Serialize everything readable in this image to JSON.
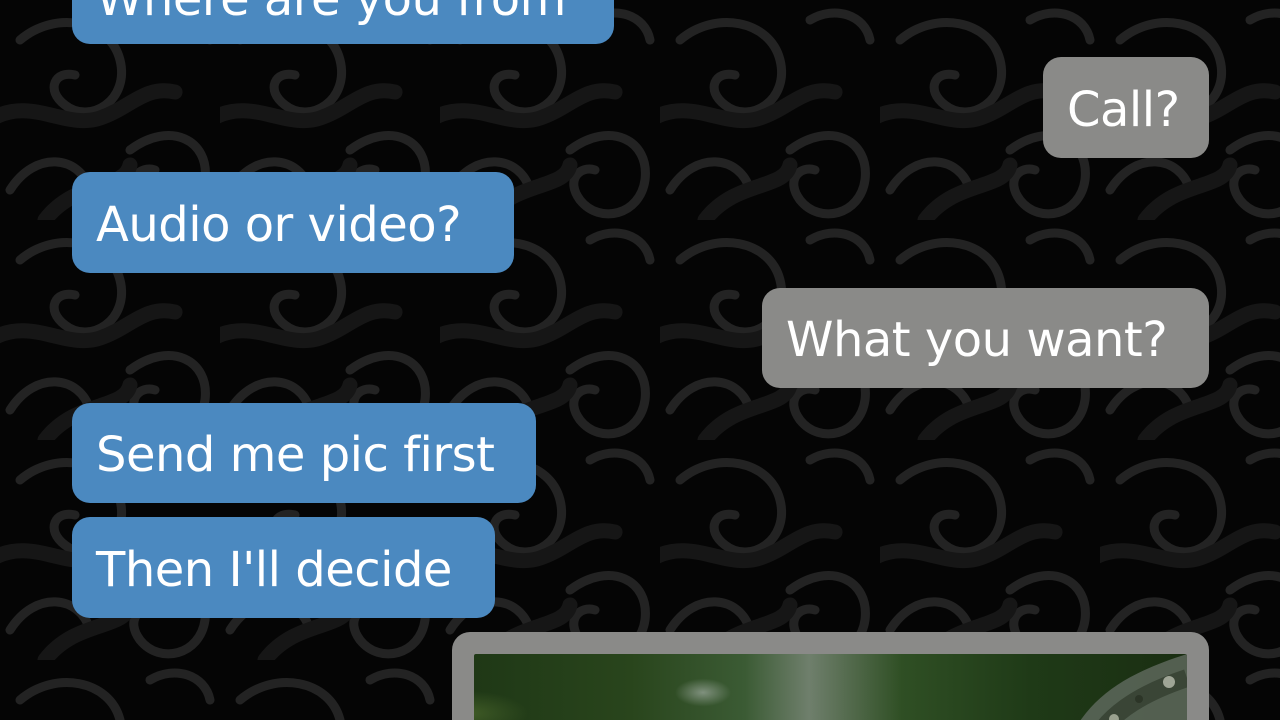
{
  "chat": {
    "messages": [
      {
        "direction": "incoming",
        "text": "Where are you from"
      },
      {
        "direction": "outgoing",
        "text": "Call?"
      },
      {
        "direction": "incoming",
        "text": "Audio or video?"
      },
      {
        "direction": "outgoing",
        "text": "What you want?"
      },
      {
        "direction": "incoming",
        "text": "Send me pic first"
      },
      {
        "direction": "incoming",
        "text": "Then I'll decide"
      }
    ],
    "attachment": {
      "direction": "outgoing",
      "type": "photo"
    }
  },
  "colors": {
    "incoming_bubble": "#4b89c0",
    "outgoing_bubble": "#8a8a88",
    "message_text": "#ffffff",
    "background": "#050505",
    "ornament": "#2a2a2a"
  }
}
